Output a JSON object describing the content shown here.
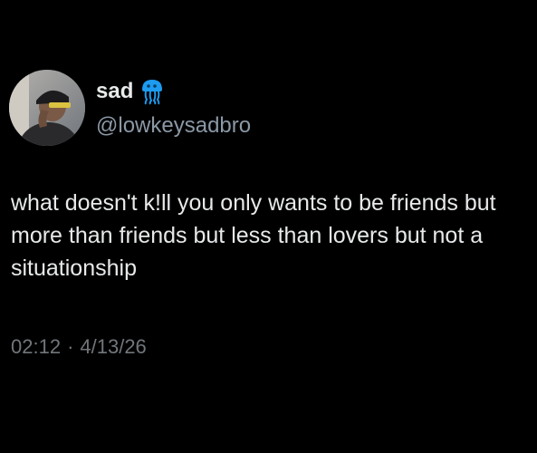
{
  "tweet": {
    "display_name": "sad",
    "handle": "@lowkeysadbro",
    "badge_icon": "jellyfish-icon",
    "text": "what doesn't k!ll you only wants to be friends but more than friends but less than lovers but not a situationship",
    "time": "02:12",
    "separator": "·",
    "date": "4/13/26"
  },
  "colors": {
    "background": "#000000",
    "text": "#e7e9ea",
    "secondary": "#71767b",
    "badge": "#1d9bf0"
  }
}
